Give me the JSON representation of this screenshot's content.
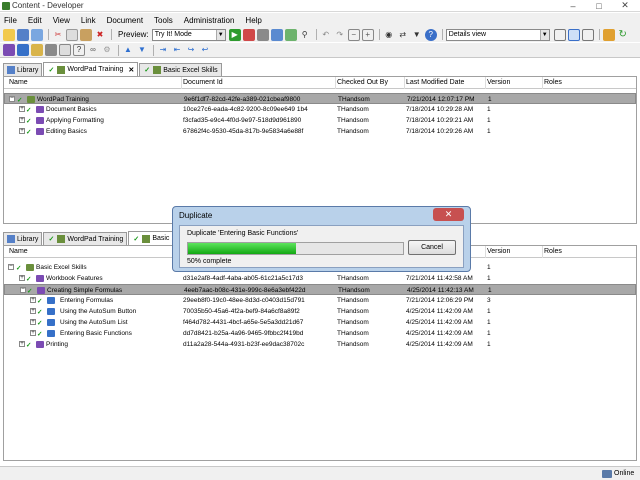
{
  "window": {
    "title": "Content - Developer"
  },
  "menu": [
    "File",
    "Edit",
    "View",
    "Link",
    "Document",
    "Tools",
    "Administration",
    "Help"
  ],
  "toolbar": {
    "preview_label": "Preview:",
    "preview_mode": "Try It! Mode",
    "view_mode": "Details view"
  },
  "columns": [
    "Name",
    "Document Id",
    "Checked Out By",
    "Last Modified Date",
    "Version",
    "Roles"
  ],
  "top_tabs": [
    {
      "label": "Library"
    },
    {
      "label": "WordPad Training"
    },
    {
      "label": "Basic Excel Skills"
    }
  ],
  "top_rows": [
    {
      "name": "WordPad Training",
      "id": "9e6f1df7-82cd-42fe-a389-021cbeaf9800",
      "checked_out_by": "THandsom",
      "modified": "7/21/2014 12:07:17 PM",
      "version": "1",
      "roles": ""
    },
    {
      "name": "Document Basics",
      "id": "10ce27c6-eada-4c82-9200-8c09ee649 1b4",
      "checked_out_by": "THandsom",
      "modified": "7/18/2014 10:29:28 AM",
      "version": "1",
      "roles": ""
    },
    {
      "name": "Applying Formatting",
      "id": "f3cfad35-e9c4-4f0d-9e97-518d9d961890",
      "checked_out_by": "THandsom",
      "modified": "7/18/2014 10:29:21 AM",
      "version": "1",
      "roles": ""
    },
    {
      "name": "Editing Basics",
      "id": "67862f4c-9530-45da-817b-9e5834a6e88f",
      "checked_out_by": "THandsom",
      "modified": "7/18/2014 10:29:26 AM",
      "version": "1",
      "roles": ""
    }
  ],
  "bottom_tabs": [
    {
      "label": "Library"
    },
    {
      "label": "WordPad Training"
    },
    {
      "label": "Basic"
    }
  ],
  "bottom_rows": [
    {
      "name": "Basic Excel Skills",
      "id": "",
      "checked_out_by": "",
      "modified": "",
      "version": "1",
      "roles": ""
    },
    {
      "name": "Workbook Features",
      "id": "d31e2af8-4adf-4aba-ab05-61c21a5c17d3",
      "checked_out_by": "THandsom",
      "modified": "7/21/2014 11:42:58 AM",
      "version": "1",
      "roles": ""
    },
    {
      "name": "Creating Simple Formulas",
      "id": "4eeb7aac-b08c-431e-999c-8e6a3ebf422d",
      "checked_out_by": "THandsom",
      "modified": "4/25/2014 11:42:13 AM",
      "version": "1",
      "roles": ""
    },
    {
      "name": "Entering Formulas",
      "id": "29eeb8f0-19c0-48ee-8d3d-c0403d15d791",
      "checked_out_by": "THandsom",
      "modified": "7/21/2014 12:06:29 PM",
      "version": "3",
      "roles": ""
    },
    {
      "name": "Using the AutoSum Button",
      "id": "70035b50-45a6-4f2a-bef9-84a6cf8a89f2",
      "checked_out_by": "THandsom",
      "modified": "4/25/2014 11:42:09 AM",
      "version": "1",
      "roles": ""
    },
    {
      "name": "Using the AutoSum List",
      "id": "f464d782-4431-4bcf-a65e-5e5a3dd21d67",
      "checked_out_by": "THandsom",
      "modified": "4/25/2014 11:42:09 AM",
      "version": "1",
      "roles": ""
    },
    {
      "name": "Entering Basic Functions",
      "id": "dd7d8421-b25a-4a96-9465-9fbbc2f419bd",
      "checked_out_by": "THandsom",
      "modified": "4/25/2014 11:42:09 AM",
      "version": "1",
      "roles": ""
    },
    {
      "name": "Printing",
      "id": "d11a2a28-544a-4931-b23f-ee9dac38702c",
      "checked_out_by": "THandsom",
      "modified": "4/25/2014 11:42:09 AM",
      "version": "1",
      "roles": ""
    }
  ],
  "dialog": {
    "title": "Duplicate",
    "message": "Duplicate 'Entering Basic Functions'",
    "progress": 0.5,
    "progress_text": "50% complete",
    "cancel_label": "Cancel"
  },
  "status": {
    "connection": "Online"
  },
  "colors": {
    "selected_row": "#a8a8a8",
    "progress": "#12a812",
    "dialog_frame": "#b9d1ea"
  }
}
